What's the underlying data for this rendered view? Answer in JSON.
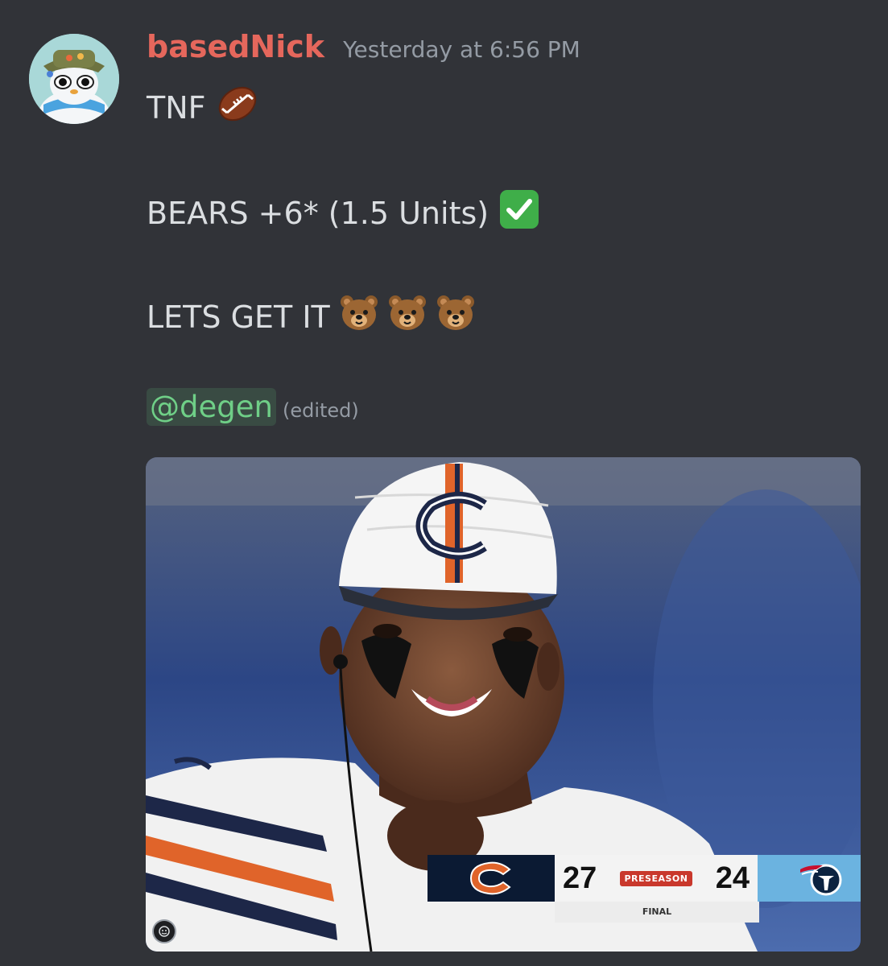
{
  "message": {
    "username": "basedNick",
    "timestamp": "Yesterday at 6:56 PM",
    "lines": [
      "TNF",
      "BEARS +6* (1.5 Units)",
      "LETS GET IT"
    ],
    "mention": "@degen",
    "edited_label": "(edited)"
  },
  "emojis": {
    "football": "football-emoji",
    "check": "check-mark-emoji",
    "bear": "bear-emoji"
  },
  "embed": {
    "scorebug": {
      "home_score": "27",
      "away_score": "24",
      "badge": "PRESEASON",
      "status": "FINAL"
    }
  },
  "colors": {
    "background": "#313338",
    "username": "#e5675c",
    "timestamp": "#949ba4",
    "mention_text": "#6fcf87"
  }
}
